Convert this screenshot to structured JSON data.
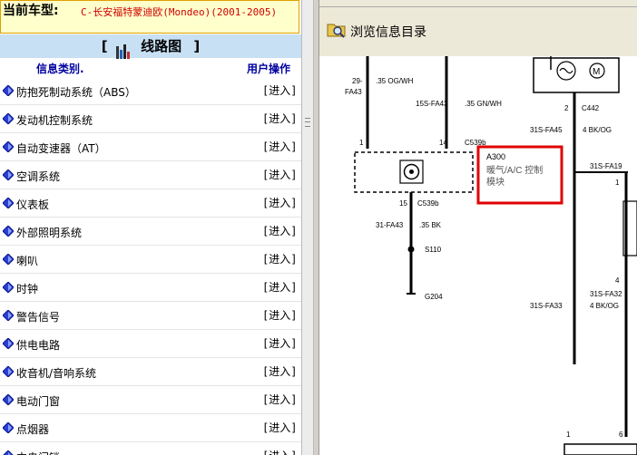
{
  "vehicle": {
    "label": "当前车型:",
    "model": "C-长安福特蒙迪欧(Mondeo)(2001-2005)"
  },
  "left_panel": {
    "title": "线路图",
    "title_bracket_left": "[",
    "title_bracket_right": "]",
    "col_category": "信息类别.",
    "col_action": "用户操作",
    "action_label": "[进入]",
    "items": [
      {
        "label": "防抱死制动系统（ABS）"
      },
      {
        "label": "发动机控制系统"
      },
      {
        "label": "自动变速器（AT）"
      },
      {
        "label": "空调系统"
      },
      {
        "label": "仪表板"
      },
      {
        "label": "外部照明系统"
      },
      {
        "label": "喇叭"
      },
      {
        "label": "时钟"
      },
      {
        "label": "警告信号"
      },
      {
        "label": "供电电路"
      },
      {
        "label": "收音机/音响系统"
      },
      {
        "label": "电动门窗"
      },
      {
        "label": "点烟器"
      },
      {
        "label": "中央门锁"
      }
    ]
  },
  "right_panel": {
    "toolbar_button": "浏览信息目录",
    "diagram": {
      "w1_num": "29-",
      "w1_circuit": "FA43",
      "w1_wire": ".35 OG/WH",
      "w2_circuit": "15S-FA43",
      "w2_wire": ".35 GN/WH",
      "pin_1": "1",
      "pin_14": "14",
      "conn_c539b": "C539b",
      "module_id": "A300",
      "module_name_1": "暖气/A/C 控制",
      "module_name_2": "模块",
      "pin_15": "15",
      "conn_c539b_2": "C539b",
      "w3_circuit": "31-FA43",
      "w3_wire": ".35 BK",
      "splice": "S110",
      "ground": "G204",
      "pin_2": "2",
      "conn_c442": "C442",
      "w4_circuit": "31S-FA45",
      "w4_wire": "4 BK/OG",
      "w5_circuit": "31S-FA19",
      "pin_1b": "1",
      "pin_4": "4",
      "w6_circuit": "31S-FA32",
      "w6_wire": "4 BK/OG",
      "w7_circuit": "31S-FA33",
      "w7_wire": "4 BK/OG",
      "pin_1c": "1",
      "pin_6": "6"
    }
  },
  "colors": {
    "highlight": "#e00000",
    "header_bg": "#c8e0f4",
    "vehicle_bg": "#ffffcc",
    "model_text": "#d00000",
    "category_header": "#0000a0"
  }
}
